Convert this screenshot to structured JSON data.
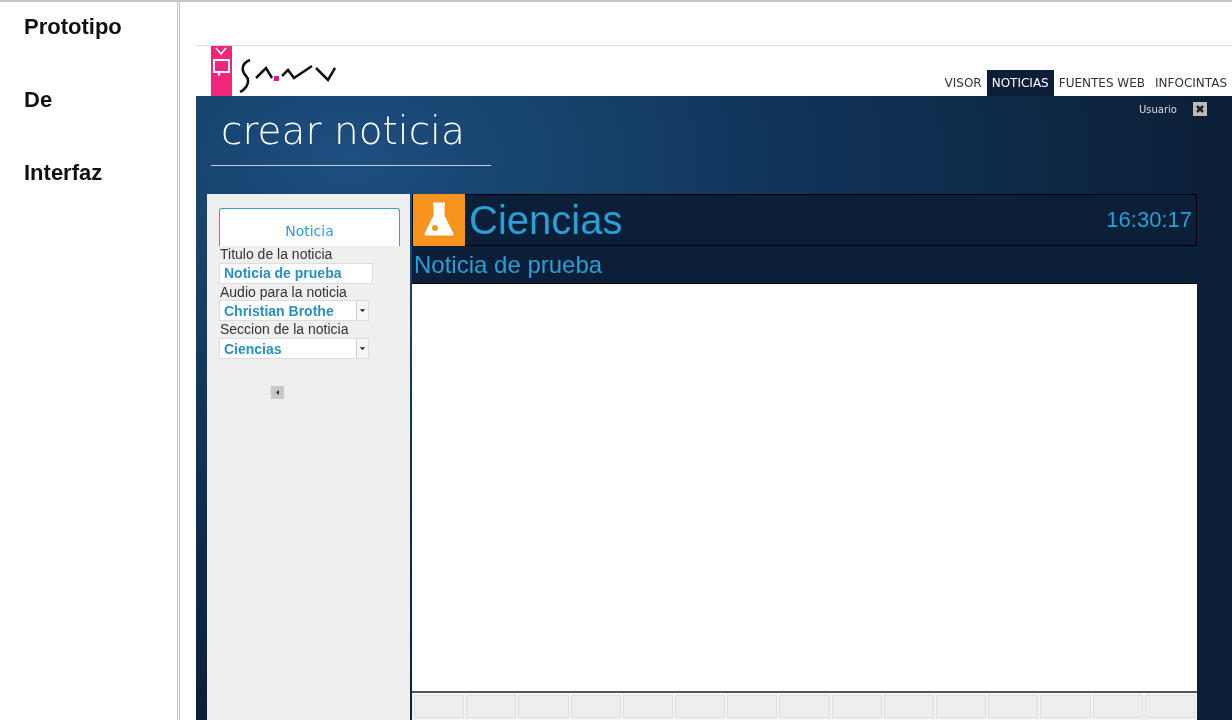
{
  "doc_labels": [
    "Prototipo",
    "De",
    "Interfaz"
  ],
  "app": {
    "nav": [
      {
        "label": "VISOR",
        "selected": false
      },
      {
        "label": "NOTICIAS",
        "selected": true
      },
      {
        "label": "FUENTES WEB",
        "selected": false
      },
      {
        "label": "INFOCINTAS",
        "selected": false
      }
    ],
    "page_title": "crear noticia",
    "user": "Usuario",
    "form": {
      "tab": "Noticia",
      "fields": [
        {
          "kind": "text",
          "label": "Titulo de la noticia",
          "value": "Noticia de prueba"
        },
        {
          "kind": "select",
          "label": "Audio para la noticia",
          "value": "Christian Brothe"
        },
        {
          "kind": "select",
          "label": "Seccion de la noticia",
          "value": "Ciencias"
        }
      ]
    },
    "preview": {
      "section": "Ciencias",
      "time": "16:30:17",
      "headline": "Noticia de prueba"
    }
  }
}
